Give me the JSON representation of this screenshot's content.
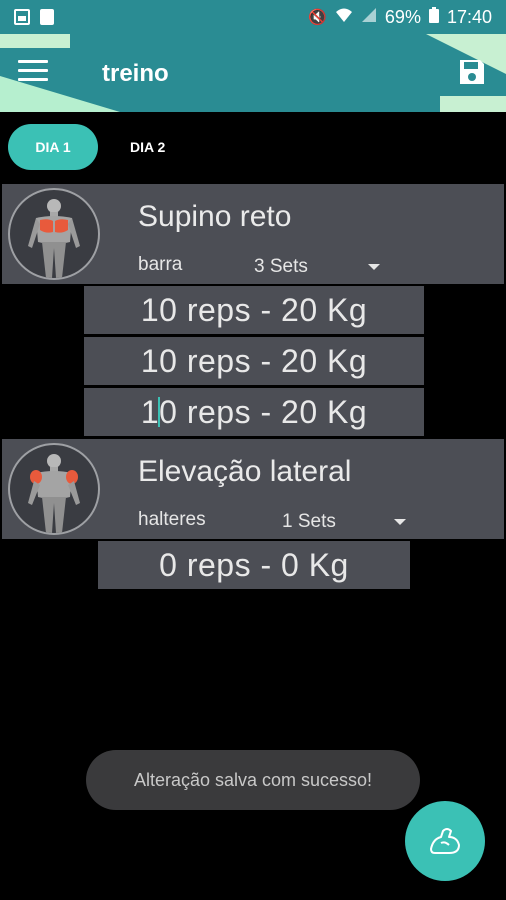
{
  "status_bar": {
    "battery": "69%",
    "time": "17:40"
  },
  "toolbar": {
    "title": "treino",
    "accent_color": "#2a8c93"
  },
  "tabs": [
    {
      "label": "DIA 1",
      "active": true
    },
    {
      "label": "DIA 2",
      "active": false
    }
  ],
  "exercises": [
    {
      "name": "Supino reto",
      "equipment": "barra",
      "sets_label": "3 Sets",
      "avatar_icon": "chest-muscle-icon",
      "sets": [
        {
          "text": "10 reps - 20 Kg"
        },
        {
          "text": "10 reps - 20 Kg"
        },
        {
          "text_before_cursor": "1",
          "text_after_cursor": "0 reps - 20 Kg"
        }
      ]
    },
    {
      "name": "Elevação lateral",
      "equipment": "halteres",
      "sets_label": "1 Sets",
      "avatar_icon": "shoulder-muscle-icon",
      "sets": [
        {
          "text": "0 reps - 0 Kg"
        }
      ]
    }
  ],
  "toast": {
    "message": "Alteração salva com sucesso!"
  },
  "fab": {
    "icon": "flexed-arm-icon",
    "color": "#3bc1b5"
  }
}
